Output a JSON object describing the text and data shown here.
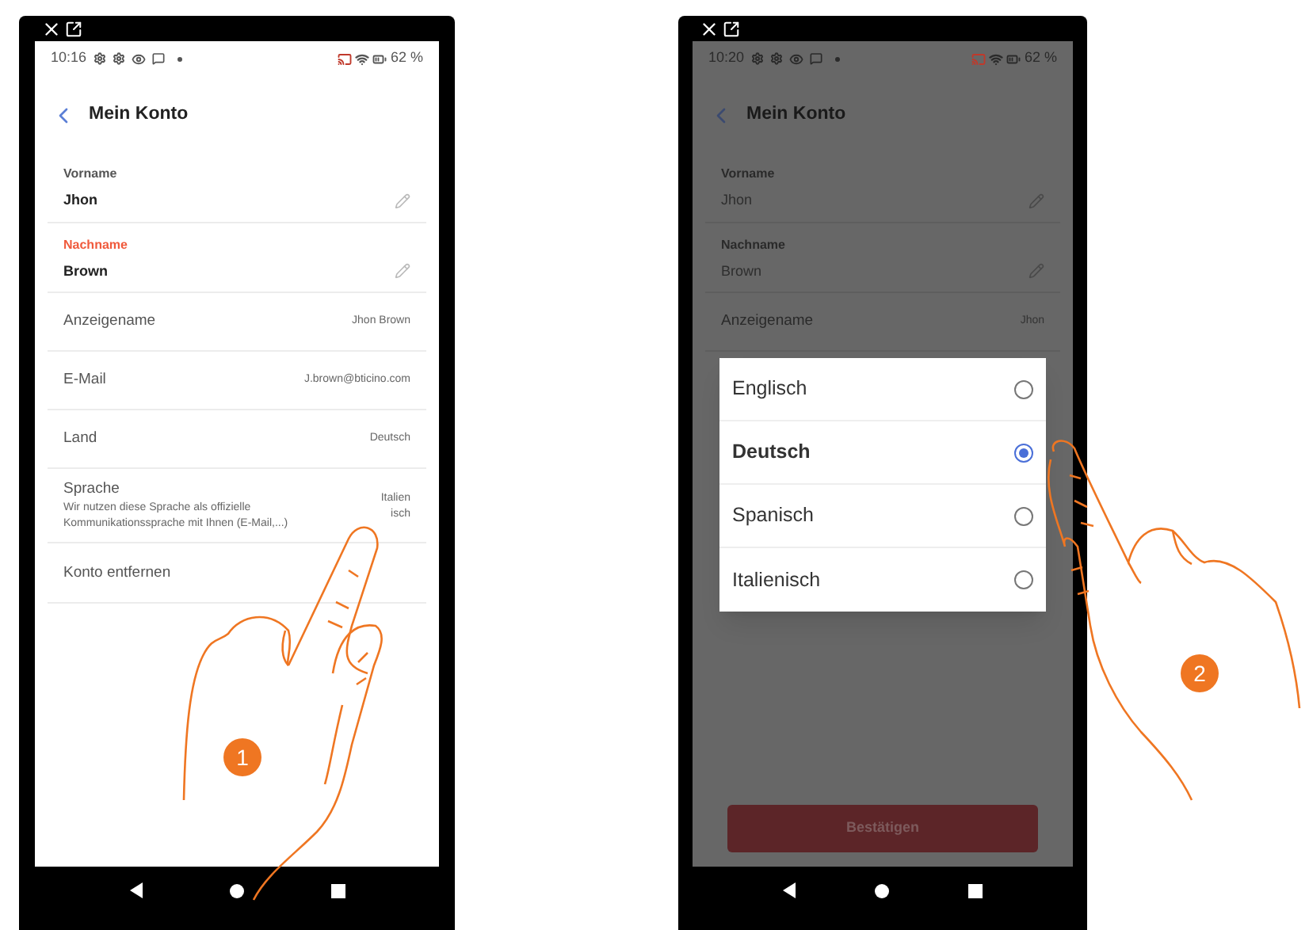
{
  "left_phone": {
    "status_bar": {
      "time": "10:16",
      "battery": "62 %"
    },
    "header": {
      "title": "Mein Konto"
    },
    "fields": [
      {
        "kind": "editable",
        "label": "Vorname",
        "value": "Jhon",
        "active": false
      },
      {
        "kind": "editable",
        "label": "Nachname",
        "value": "Brown",
        "active": true
      },
      {
        "kind": "row",
        "label": "Anzeigename",
        "value": "Jhon Brown"
      },
      {
        "kind": "row",
        "label": "E-Mail",
        "value": "J.brown@bticino.com"
      },
      {
        "kind": "row",
        "label": "Land",
        "value": "Deutsch"
      },
      {
        "kind": "note",
        "label": "Sprache",
        "note": "Wir nutzen diese Sprache als offizielle Kommunikationssprache mit Ihnen (E-Mail,...)",
        "value_lines": [
          "Italien",
          "isch"
        ]
      },
      {
        "kind": "action",
        "label": "Konto entfernen"
      }
    ],
    "step_badge": "1"
  },
  "right_phone": {
    "status_bar": {
      "time": "10:20",
      "battery": "62 %"
    },
    "header": {
      "title": "Mein Konto"
    },
    "fields": [
      {
        "kind": "editable",
        "label": "Vorname",
        "value": "Jhon",
        "active": false
      },
      {
        "kind": "editable",
        "label": "Nachname",
        "value": "Brown",
        "active": false
      },
      {
        "kind": "row",
        "label": "Anzeigename",
        "value": "Jhon"
      }
    ],
    "dialog": {
      "options": [
        {
          "label": "Englisch",
          "selected": false
        },
        {
          "label": "Deutsch",
          "selected": true
        },
        {
          "label": "Spanisch",
          "selected": false
        },
        {
          "label": "Italienisch",
          "selected": false
        }
      ]
    },
    "confirm_button": {
      "label": "Bestätigen",
      "disabled": true
    },
    "step_badge": "2"
  }
}
